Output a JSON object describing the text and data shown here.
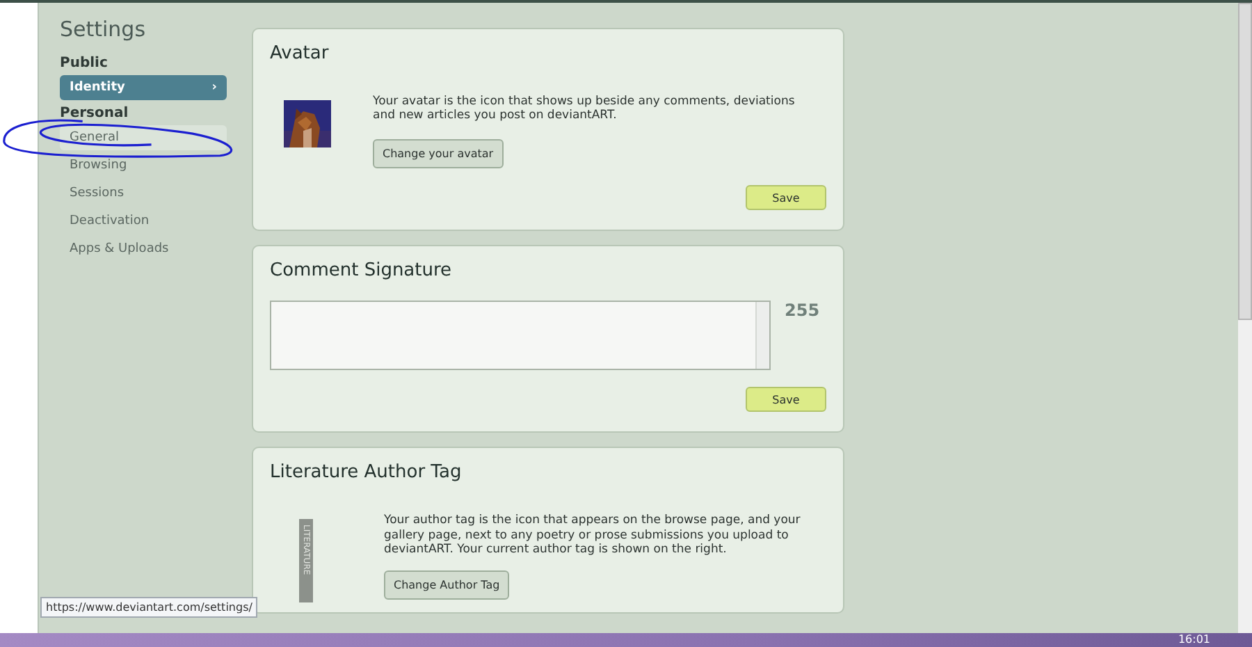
{
  "sidebar": {
    "title": "Settings",
    "groups": [
      {
        "label": "Public",
        "items": [
          {
            "label": "Identity",
            "selected": true,
            "chevron": "›"
          }
        ]
      },
      {
        "label": "Personal",
        "items": [
          {
            "label": "General",
            "selected": false,
            "hover": true
          },
          {
            "label": "Browsing",
            "selected": false,
            "hover": false
          },
          {
            "label": "Sessions",
            "selected": false,
            "hover": false
          },
          {
            "label": "Deactivation",
            "selected": false,
            "hover": false
          },
          {
            "label": "Apps & Uploads",
            "selected": false,
            "hover": false
          }
        ]
      }
    ]
  },
  "avatar_card": {
    "title": "Avatar",
    "description": "Your avatar is the icon that shows up beside any comments, deviations and new articles you post on deviantART.",
    "change_button": "Change your avatar",
    "save_button": "Save"
  },
  "signature_card": {
    "title": "Comment Signature",
    "counter": "255",
    "save_button": "Save"
  },
  "author_tag_card": {
    "title": "Literature Author Tag",
    "tag_label": "LITERATURE",
    "description": "Your author tag is the icon that appears on the browse page, and your gallery page, next to any poetry or prose submissions you upload to deviantART. Your current author tag is shown on the right.",
    "change_button": "Change Author Tag"
  },
  "status_url": "https://www.deviantart.com/settings/",
  "taskbar": {
    "clock": "16:01"
  }
}
